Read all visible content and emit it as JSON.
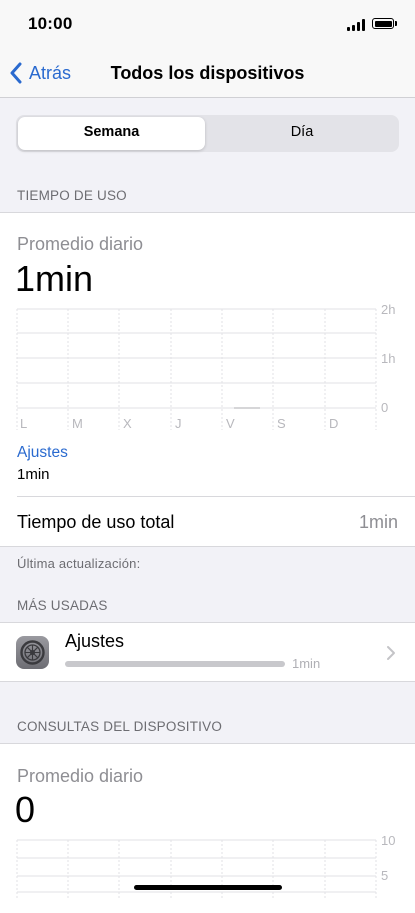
{
  "status": {
    "time": "10:00"
  },
  "nav": {
    "back_label": "Atrás",
    "title": "Todos los dispositivos"
  },
  "segmented": {
    "options": [
      "Semana",
      "Día"
    ],
    "selected": "Semana"
  },
  "screen_time": {
    "header": "TIEMPO DE USO",
    "avg_label": "Promedio diario",
    "avg_value": "1min",
    "chart": {
      "y_ticks": [
        "2h",
        "1h",
        "0"
      ],
      "days": [
        "L",
        "M",
        "X",
        "J",
        "V",
        "S",
        "D"
      ]
    },
    "top_app_label": "Ajustes",
    "top_app_value": "1min",
    "total_label": "Tiempo de uso total",
    "total_value": "1min",
    "last_update": "Última actualización:"
  },
  "most_used": {
    "header": "MÁS USADAS",
    "apps": [
      {
        "name": "Ajustes",
        "usage": "1min",
        "icon": "settings-gear-icon"
      }
    ]
  },
  "pickups": {
    "header": "CONSULTAS DEL DISPOSITIVO",
    "avg_label": "Promedio diario",
    "avg_value": "0",
    "y_ticks": [
      "10",
      "5"
    ]
  },
  "colors": {
    "link": "#2a6acf",
    "background": "#f2f2f7"
  }
}
